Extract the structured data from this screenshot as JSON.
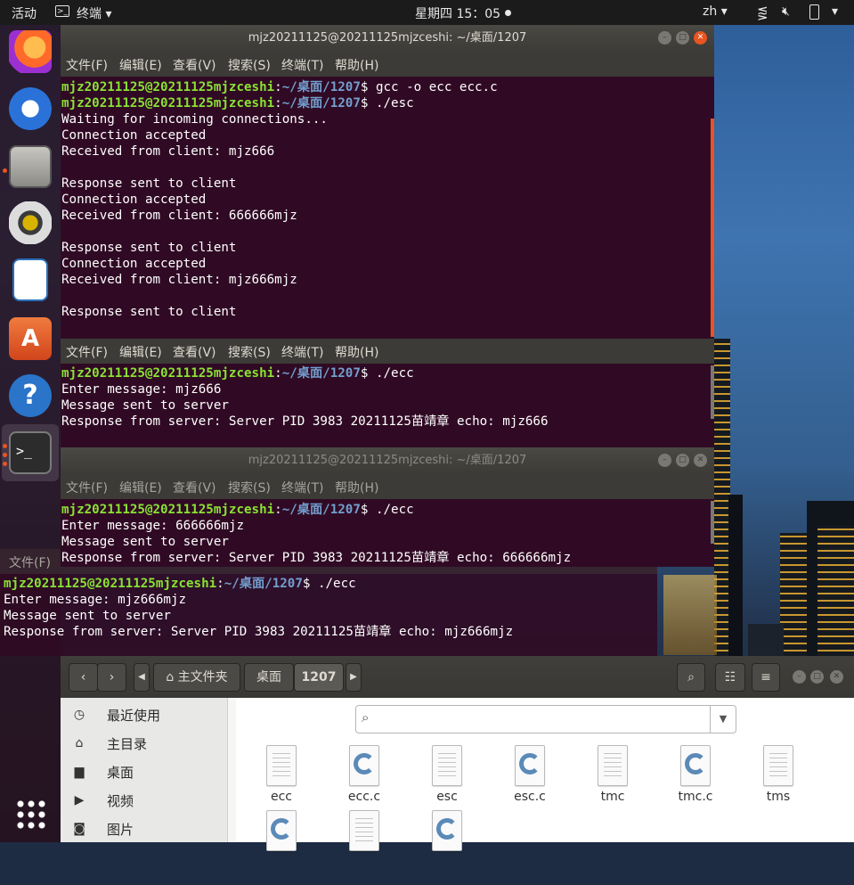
{
  "topbar": {
    "activities": "活动",
    "app_name": "终端",
    "app_menu_arrow": "▾",
    "clock": "星期四 15：05",
    "input_method": "zh",
    "im_arrow": "▾"
  },
  "terminal_1": {
    "title": "mjz20211125@20211125mjzceshi: ~/桌面/1207",
    "menu": [
      "文件(F)",
      "编辑(E)",
      "查看(V)",
      "搜索(S)",
      "终端(T)",
      "帮助(H)"
    ],
    "prompt_user": "mjz20211125@20211125mjzceshi",
    "prompt_path": "~/桌面/1207",
    "lines": [
      {
        "kind": "prompt",
        "cmd": " gcc -o ecc ecc.c"
      },
      {
        "kind": "prompt",
        "cmd": " ./esc"
      },
      {
        "kind": "text",
        "text": "Waiting for incoming connections..."
      },
      {
        "kind": "text",
        "text": "Connection accepted"
      },
      {
        "kind": "text",
        "text": "Received from client: mjz666"
      },
      {
        "kind": "text",
        "text": ""
      },
      {
        "kind": "text",
        "text": "Response sent to client"
      },
      {
        "kind": "text",
        "text": "Connection accepted"
      },
      {
        "kind": "text",
        "text": "Received from client: 666666mjz"
      },
      {
        "kind": "text",
        "text": ""
      },
      {
        "kind": "text",
        "text": "Response sent to client"
      },
      {
        "kind": "text",
        "text": "Connection accepted"
      },
      {
        "kind": "text",
        "text": "Received from client: mjz666mjz"
      },
      {
        "kind": "text",
        "text": ""
      },
      {
        "kind": "text",
        "text": "Response sent to client"
      }
    ]
  },
  "terminal_2": {
    "menu": [
      "文件(F)",
      "编辑(E)",
      "查看(V)",
      "搜索(S)",
      "终端(T)",
      "帮助(H)"
    ],
    "lines": [
      {
        "kind": "prompt",
        "cmd": " ./ecc"
      },
      {
        "kind": "text",
        "text": "Enter message: mjz666"
      },
      {
        "kind": "text",
        "text": "Message sent to server"
      },
      {
        "kind": "text",
        "text": "Response from server: Server PID 3983 20211125苗靖章 echo: mjz666"
      }
    ]
  },
  "terminal_3": {
    "title": "mjz20211125@20211125mjzceshi: ~/桌面/1207",
    "menu": [
      "文件(F)",
      "编辑(E)",
      "查看(V)",
      "搜索(S)",
      "终端(T)",
      "帮助(H)"
    ],
    "lines": [
      {
        "kind": "prompt",
        "cmd": " ./ecc"
      },
      {
        "kind": "text",
        "text": "Enter message: 666666mjz"
      },
      {
        "kind": "text",
        "text": "Message sent to server"
      },
      {
        "kind": "text",
        "text": "Response from server: Server PID 3983 20211125苗靖章 echo: 666666mjz"
      }
    ]
  },
  "terminal_4": {
    "menu_partial": "文件(F)",
    "lines": [
      {
        "kind": "prompt",
        "cmd": " ./ecc"
      },
      {
        "kind": "text",
        "text": "Enter message: mjz666mjz"
      },
      {
        "kind": "text",
        "text": "Message sent to server"
      },
      {
        "kind": "text",
        "text": "Response from server: Server PID 3983 20211125苗靖章 echo: mjz666mjz"
      }
    ]
  },
  "files": {
    "breadcrumb": [
      "主文件夹",
      "桌面",
      "1207"
    ],
    "sidebar": [
      "最近使用",
      "主目录",
      "桌面",
      "视频",
      "图片"
    ],
    "items": [
      {
        "name": "ecc",
        "type": "binary"
      },
      {
        "name": "ecc.c",
        "type": "c"
      },
      {
        "name": "esc",
        "type": "binary"
      },
      {
        "name": "esc.c",
        "type": "c"
      },
      {
        "name": "tmc",
        "type": "binary"
      },
      {
        "name": "tmc.c",
        "type": "c"
      },
      {
        "name": "tms",
        "type": "binary"
      },
      {
        "name": "",
        "type": "c"
      },
      {
        "name": "",
        "type": "binary"
      },
      {
        "name": "",
        "type": "c"
      }
    ]
  },
  "colors": {
    "terminal_bg": "#300a24",
    "prompt_user": "#8ae234",
    "prompt_path": "#729fcf",
    "accent": "#e95420"
  }
}
